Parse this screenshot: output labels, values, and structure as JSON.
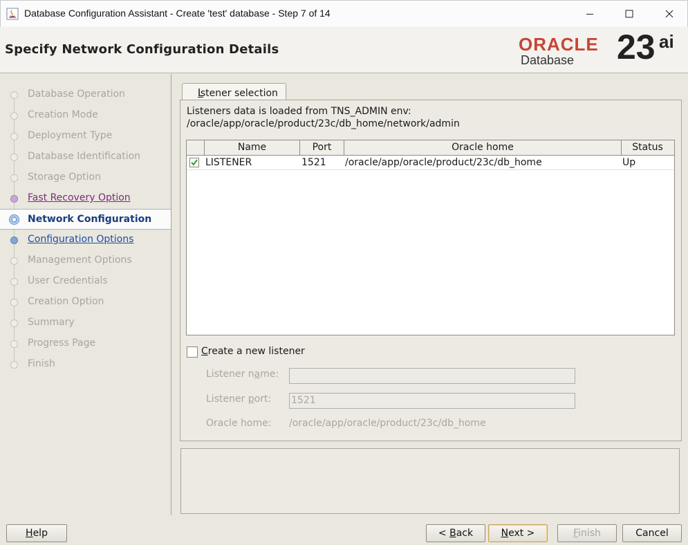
{
  "window": {
    "title": "Database Configuration Assistant - Create 'test' database - Step 7 of 14"
  },
  "header": {
    "page_title": "Specify Network Configuration Details",
    "brand_oracle": "ORACLE",
    "brand_database": "Database",
    "brand_version": "23",
    "brand_suffix": "ai"
  },
  "sidebar": {
    "steps": [
      {
        "label": "Database Operation",
        "state": "inactive"
      },
      {
        "label": "Creation Mode",
        "state": "inactive"
      },
      {
        "label": "Deployment Type",
        "state": "inactive"
      },
      {
        "label": "Database Identification",
        "state": "inactive"
      },
      {
        "label": "Storage Option",
        "state": "inactive"
      },
      {
        "label": "Fast Recovery Option",
        "state": "visited"
      },
      {
        "label": "Network Configuration",
        "state": "current"
      },
      {
        "label": "Configuration Options",
        "state": "link"
      },
      {
        "label": "Management Options",
        "state": "inactive"
      },
      {
        "label": "User Credentials",
        "state": "inactive"
      },
      {
        "label": "Creation Option",
        "state": "inactive"
      },
      {
        "label": "Summary",
        "state": "inactive"
      },
      {
        "label": "Progress Page",
        "state": "inactive"
      },
      {
        "label": "Finish",
        "state": "inactive"
      }
    ]
  },
  "listener_tab": {
    "tab_label_mnemonic": "L",
    "tab_label_rest": "istener selection",
    "info_line1": "Listeners data is loaded from TNS_ADMIN env:",
    "info_line2": "/oracle/app/oracle/product/23c/db_home/network/admin",
    "columns": [
      "Name",
      "Port",
      "Oracle home",
      "Status"
    ],
    "rows": [
      {
        "checked": true,
        "name": "LISTENER",
        "port": "1521",
        "home": "/oracle/app/oracle/product/23c/db_home",
        "status": "Up"
      }
    ],
    "create_new": {
      "checked": false,
      "label_mnemonic": "C",
      "label_rest": "reate a new listener"
    },
    "listener_name": {
      "label_a": "Listener n",
      "label_m": "a",
      "label_b": "me:",
      "value": ""
    },
    "listener_port": {
      "label_a": "Listener ",
      "label_m": "p",
      "label_b": "ort:",
      "value": "1521"
    },
    "oracle_home": {
      "label": "Oracle home:",
      "value": "/oracle/app/oracle/product/23c/db_home"
    }
  },
  "buttons": {
    "help": {
      "m": "H",
      "rest": "elp"
    },
    "back": {
      "pre": "< ",
      "m": "B",
      "rest": "ack"
    },
    "next": {
      "m": "N",
      "rest": "ext >"
    },
    "finish": {
      "m": "F",
      "rest": "inish"
    },
    "cancel": "Cancel"
  },
  "colors": {
    "visited_link": "#7b2a80",
    "link": "#1f4ea3",
    "current_step": "#1b3d80",
    "oracle_red": "#c74634"
  }
}
